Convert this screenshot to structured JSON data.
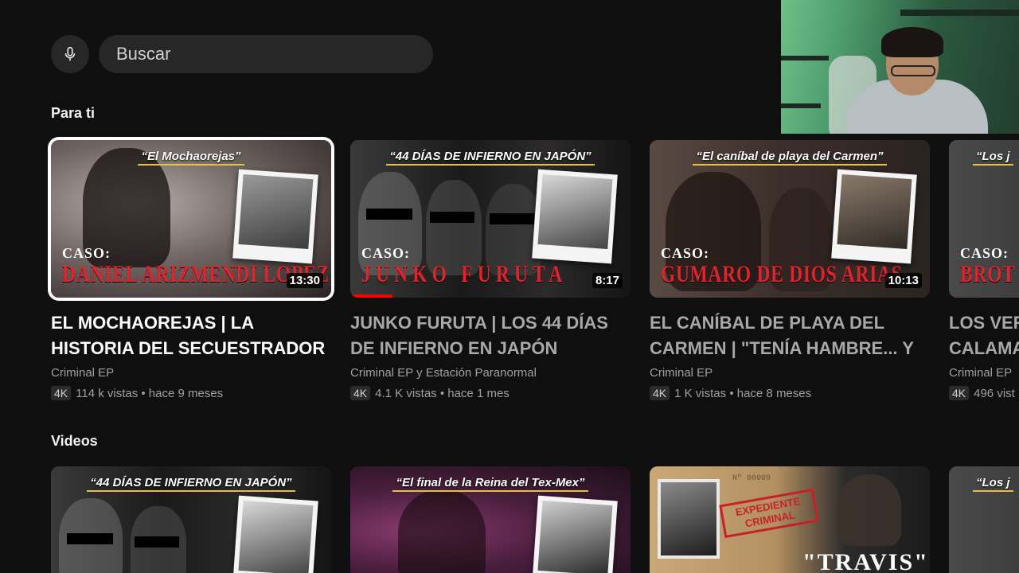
{
  "search": {
    "placeholder": "Buscar",
    "mic_icon": "microphone-icon"
  },
  "sections": {
    "for_you": "Para ti",
    "videos": "Videos"
  },
  "colors": {
    "background": "#0f0f0f",
    "search_bg": "#272727",
    "name_red": "#e0242b",
    "progress": "#ff0000"
  },
  "for_you": [
    {
      "headline": "“El Mochaorejas”",
      "caso": "CASO:",
      "name": "DANIEL ARIZMENDI LOPEZ",
      "duration": "13:30",
      "title_line1": "EL MOCHAOREJAS | LA",
      "title_line2": "HISTORIA DEL SECUESTRADOR",
      "channel": "Criminal EP",
      "badge": "4K",
      "stats": "114 k vistas • hace 9 meses"
    },
    {
      "headline": "“44 DÍAS DE INFIERNO EN JAPÓN”",
      "caso": "CASO:",
      "name": "JUNKO FURUTA",
      "duration": "8:17",
      "progress": 0.15,
      "title_line1": "JUNKO FURUTA | LOS 44 DÍAS",
      "title_line2": "DE INFIERNO EN JAPÓN",
      "channel": "Criminal EP y Estación Paranormal",
      "badge": "4K",
      "stats": "4.1 K vistas • hace 1 mes"
    },
    {
      "headline": "“El caníbal de playa del Carmen”",
      "caso": "CASO:",
      "name": "GUMARO DE DIOS ARIAS",
      "duration": "10:13",
      "title_line1": "EL CANÍBAL DE PLAYA DEL",
      "title_line2": "CARMEN | \"TENÍA HAMBRE... Y",
      "channel": "Criminal EP",
      "badge": "4K",
      "stats": "1 K vistas • hace 8 meses"
    },
    {
      "headline": "“Los j",
      "caso": "CASO:",
      "name": "BROT",
      "title_line1": "LOS VER",
      "title_line2": "CALAMA",
      "channel": "Criminal EP",
      "badge": "4K",
      "stats": "496 vist"
    }
  ],
  "videos": [
    {
      "headline": "“44 DÍAS DE INFIERNO EN JAPÓN”"
    },
    {
      "headline": "“El final de la Reina del Tex-Mex”"
    },
    {
      "stamp_line1": "EXPEDIENTE",
      "stamp_line2": "CRIMINAL",
      "folder_number": "Nº 00009",
      "name": "\"TRAVIS\""
    },
    {
      "headline": "“Los j"
    }
  ]
}
